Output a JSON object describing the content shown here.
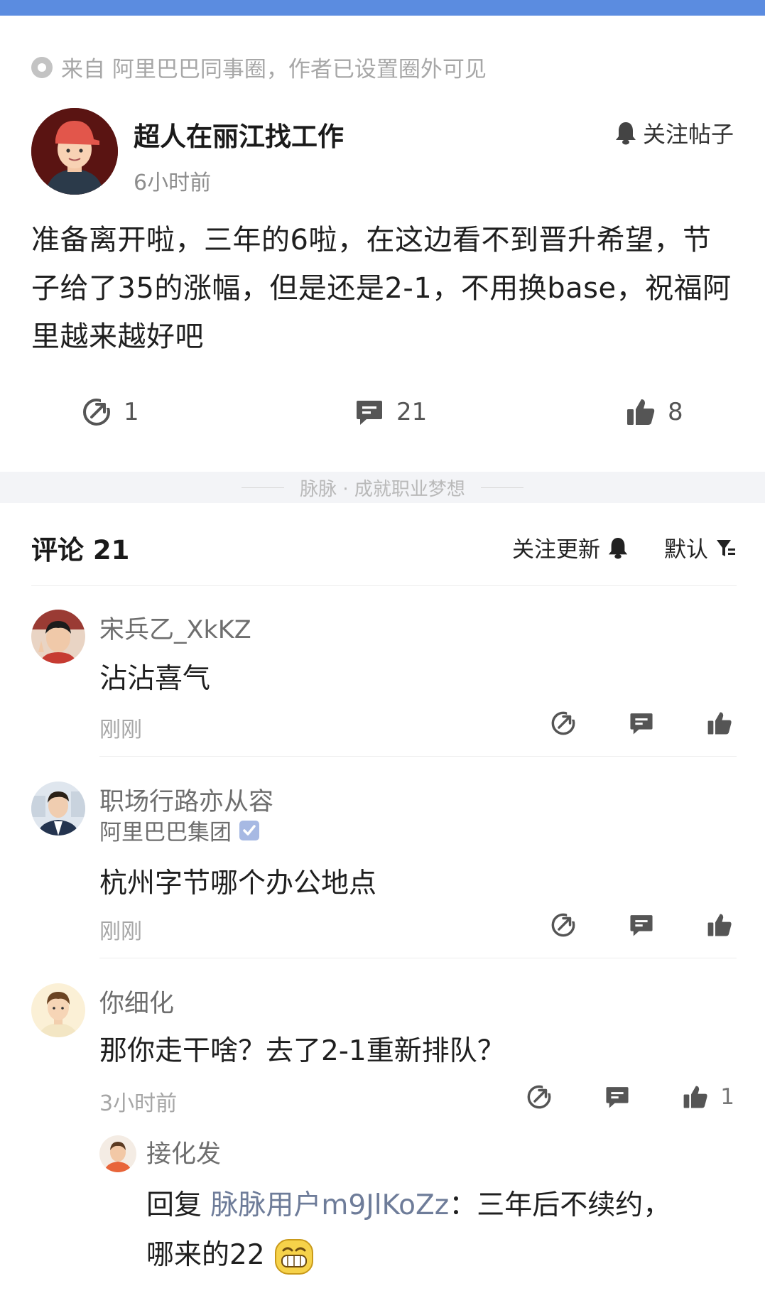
{
  "source": {
    "text": "来自 阿里巴巴同事圈，作者已设置圈外可见"
  },
  "post": {
    "author": "超人在丽江找工作",
    "time": "6小时前",
    "follow_label": "关注帖子",
    "body": "准备离开啦，三年的6啦，在这边看不到晋升希望，节子给了35的涨幅，但是还是2-1，不用换base，祝福阿里越来越好吧",
    "stats": {
      "shares": "1",
      "comments": "21",
      "likes": "8"
    }
  },
  "divider": {
    "text": "脉脉 · 成就职业梦想"
  },
  "comments_header": {
    "title": "评论 21",
    "follow_updates": "关注更新",
    "sort": "默认"
  },
  "comments": [
    {
      "name": "宋兵乙_XkKZ",
      "body": "沾沾喜气",
      "time": "刚刚",
      "likes": ""
    },
    {
      "name": "职场行路亦从容",
      "company": "阿里巴巴集团",
      "body": "杭州字节哪个办公地点",
      "time": "刚刚",
      "likes": ""
    },
    {
      "name": "你细化",
      "body": "那你走干啥？去了2-1重新排队？",
      "time": "3小时前",
      "likes": "1"
    }
  ],
  "reply": {
    "name": "接化发",
    "prefix": "回复 ",
    "mention": "脉脉用户m9JlKoZz",
    "colon": "：",
    "body_line1": "三年后不续约，",
    "body_line2": "哪来的22"
  },
  "icons": {
    "source": "circle-dot-icon",
    "bell": "bell-icon",
    "share": "share-icon",
    "comment": "comment-icon",
    "like": "thumbs-up-icon",
    "filter": "filter-icon",
    "verified": "verified-badge-icon",
    "emoji": "grinning-emoji-icon"
  },
  "colors": {
    "topbar": "#5b8ce0",
    "text": "#1f1f1f",
    "muted": "#a6a6a6",
    "mention": "#6e7c99"
  }
}
